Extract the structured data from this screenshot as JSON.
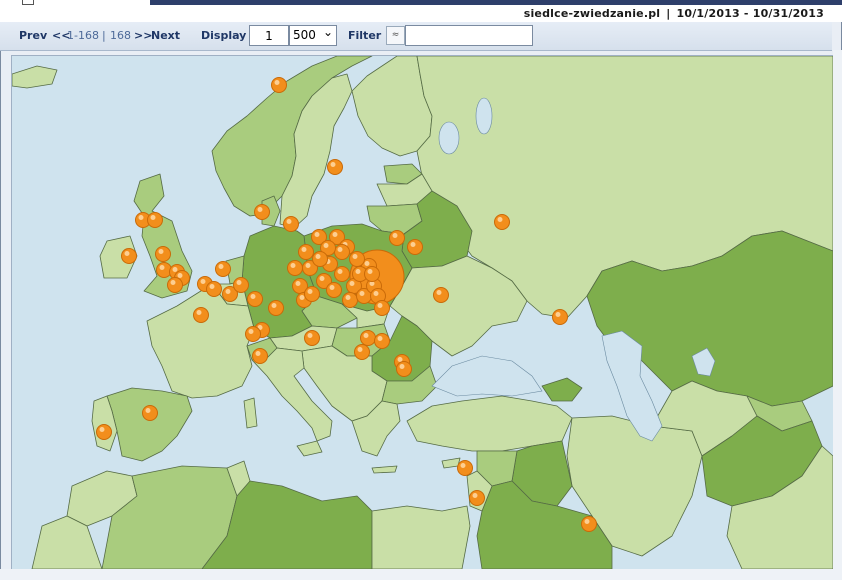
{
  "header": {
    "site": "siedlce-zwiedzanie.pl",
    "separator": "|",
    "date_range": "10/1/2013 - 10/31/2013"
  },
  "navigation": {
    "prev_label": "Prev",
    "prev_arrows": "<<",
    "range_label": "1-168",
    "range_sep": "|",
    "total_label": "168",
    "next_arrows": ">>",
    "next_label": "Next",
    "display_label": "Display",
    "display_value": "1",
    "page_size_value": "500",
    "filter_label": "Filter",
    "filter_icon": "filter-icon",
    "filter_value": ""
  },
  "map": {
    "colors": {
      "sea": "#cfe3ee",
      "land_light": "#c9dfa7",
      "land_mid": "#a9cc7e",
      "land_dark": "#7eae4c",
      "border": "#556b45",
      "lake": "#cfe3ee",
      "marker": "#f28e1c",
      "marker_edge": "#c96a08"
    },
    "marker_count": 168
  }
}
